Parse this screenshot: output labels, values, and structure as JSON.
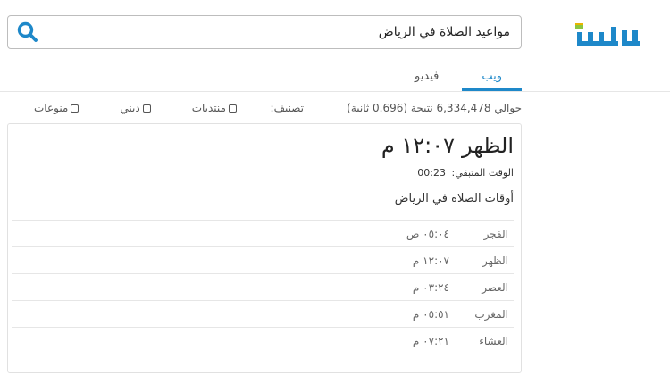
{
  "header": {
    "brand_colors": {
      "primary": "#1e88c9",
      "accent": "#8cc63f",
      "dark": "#1a6aa0"
    },
    "search": {
      "value": "مواعيد الصلاة في الرياض",
      "button_icon": "search-icon",
      "icon_color": "#1e88c9"
    }
  },
  "tabs": [
    {
      "label": "ويب",
      "active": true
    },
    {
      "label": "فيديو",
      "active": false
    }
  ],
  "results": {
    "stats": "حوالي 6,334,478 نتيجة (0.696 ثانية)",
    "classify_label": "تصنيف:",
    "filters": [
      "منوعات",
      "ديني",
      "منتديات"
    ]
  },
  "prayer": {
    "headline_name": "الظهر",
    "headline_time": "١٢:٠٧ م",
    "remaining_label": "الوقت المتبقي:",
    "remaining_value": "00:23",
    "subtitle": "أوقات الصلاة في الرياض",
    "rows": [
      {
        "name": "الفجر",
        "time": "٠٥:٠٤ ص"
      },
      {
        "name": "الظهر",
        "time": "١٢:٠٧ م"
      },
      {
        "name": "العصر",
        "time": "٠٣:٢٤ م"
      },
      {
        "name": "المغرب",
        "time": "٠٥:٥١ م"
      },
      {
        "name": "العشاء",
        "time": "٠٧:٢١ م"
      }
    ]
  }
}
